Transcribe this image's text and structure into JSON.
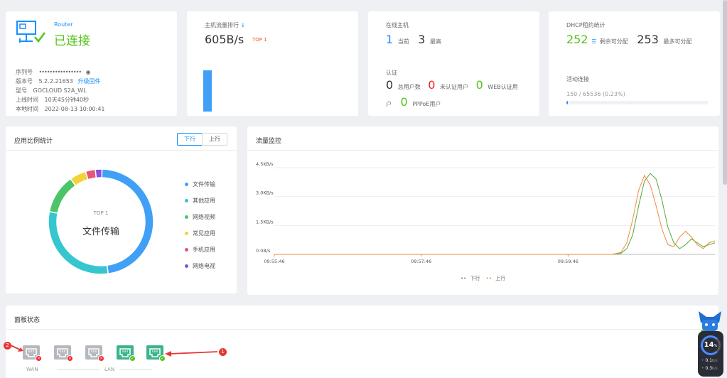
{
  "router": {
    "brand": "Router",
    "status": "已连接",
    "serial_label": "序列号",
    "serial_value": "••••••••••••••••",
    "version_label": "版本号",
    "version_value": "5.2.2.21653",
    "upgrade_link": "升级固件",
    "model_label": "型号",
    "model_value": "GOCLOUD S2A_WL",
    "uptime_label": "上线时间",
    "uptime_value": "10天45分钟40秒",
    "localtime_label": "本地时间",
    "localtime_value": "2022-08-13 10:00:41"
  },
  "traffic_rank": {
    "title": "主机流量排行",
    "value": "605B/s",
    "badge": "TOP 1",
    "bar_fill": 1.0
  },
  "online_hosts": {
    "title": "在线主机",
    "current_value": "1",
    "current_label": "当前",
    "max_value": "3",
    "max_label": "最高",
    "auth_title": "认证",
    "total_value": "0",
    "total_label": "总用户数",
    "unauth_value": "0",
    "unauth_label": "未认证用户",
    "web_value": "0",
    "web_label": "WEB认证用",
    "web_label_wrap": "户",
    "pppoe_value": "0",
    "pppoe_label": "PPPoE用户"
  },
  "dhcp": {
    "title": "DHCP租约统计",
    "remain_value": "252",
    "remain_label": "剩余可分配",
    "max_value": "253",
    "max_label": "最多可分配",
    "active_title": "活动连接",
    "active_value": "150 / 65536 (0.23%)",
    "active_fraction": 0.0023
  },
  "app_stats": {
    "title": "应用比例统计",
    "tab_down": "下行",
    "tab_up": "上行",
    "center_top": "TOP 1",
    "center_label": "文件传输",
    "legend": [
      {
        "name": "文件传输",
        "color": "#3fa0f5"
      },
      {
        "name": "其他应用",
        "color": "#36c6cf"
      },
      {
        "name": "网络视频",
        "color": "#4cc56a"
      },
      {
        "name": "常见应用",
        "color": "#f4d23a"
      },
      {
        "name": "手机应用",
        "color": "#e8537a"
      },
      {
        "name": "网络电视",
        "color": "#8c4de0"
      }
    ],
    "chart_data": {
      "type": "pie",
      "categories": [
        "文件传输",
        "其他应用",
        "网络视频",
        "常见应用",
        "手机应用",
        "网络电视"
      ],
      "values": [
        47,
        30,
        12,
        5,
        3,
        2
      ]
    }
  },
  "flow_monitor": {
    "title": "流量监控",
    "legend_down": "下行",
    "legend_up": "上行",
    "down_color": "#52a83a",
    "up_color": "#f08a3c",
    "chart_data": {
      "type": "line",
      "ylim": [
        0,
        4.5
      ],
      "yticks": [
        "0.0B/s",
        "1.5KB/s",
        "3.0KB/s",
        "4.5KB/s"
      ],
      "yvals": [
        0,
        1.5,
        3.0,
        4.5
      ],
      "xticks": [
        "09:55:46",
        "09:57:46",
        "09:59:46"
      ],
      "x": [
        0,
        100,
        200,
        230,
        236,
        240,
        244,
        248,
        252,
        256,
        260,
        264,
        268,
        272,
        276,
        280,
        284,
        288,
        292,
        296,
        300
      ],
      "series": [
        {
          "name": "下行",
          "values": [
            0,
            0,
            0,
            0,
            0.05,
            0.3,
            1.0,
            2.5,
            3.8,
            4.2,
            3.9,
            2.8,
            1.4,
            0.6,
            0.3,
            0.5,
            0.8,
            0.6,
            0.4,
            0.5,
            0.6
          ]
        },
        {
          "name": "上行",
          "values": [
            0,
            0,
            0,
            0,
            0.1,
            0.6,
            1.8,
            3.3,
            4.1,
            3.6,
            2.5,
            1.3,
            0.5,
            0.4,
            0.9,
            1.2,
            0.9,
            0.5,
            0.3,
            0.6,
            0.7
          ]
        }
      ]
    }
  },
  "panel": {
    "title": "面板状态",
    "wan_label": "WAN",
    "lan_label": "LAN",
    "callout_1": "1",
    "callout_2": "2"
  },
  "widget": {
    "value": "14",
    "unit": "%",
    "up_rate": "0.1",
    "up_unit": "K/s",
    "down_rate": "0.3",
    "down_unit": "K/s"
  }
}
